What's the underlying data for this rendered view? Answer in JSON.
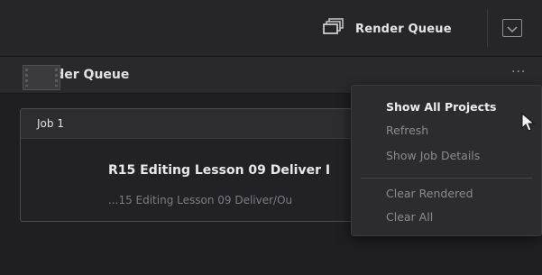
{
  "toolbar": {
    "render_queue_label": "Render Queue"
  },
  "panel": {
    "title": "Render Queue",
    "options_label": "···"
  },
  "job": {
    "header": "Job 1",
    "title": "R15 Editing Lesson 09 Deliver I",
    "path": "...15 Editing Lesson 09 Deliver/Ou"
  },
  "menu": {
    "items": [
      {
        "label": "Show All Projects",
        "enabled": true
      },
      {
        "label": "Refresh",
        "enabled": false
      },
      {
        "label": "Show Job Details",
        "enabled": false
      },
      {
        "label": "Clear Rendered",
        "enabled": false
      },
      {
        "label": "Clear All",
        "enabled": false
      }
    ]
  },
  "icons": {
    "render_queue": "render-queue-stack-icon",
    "toggle": "chevron-down-icon",
    "cursor": "mouse-pointer-icon"
  }
}
